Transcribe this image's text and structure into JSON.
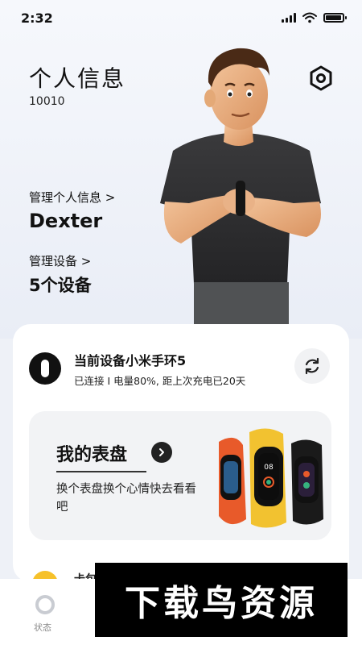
{
  "status_bar": {
    "time": "2:32",
    "battery_level": 0.95
  },
  "header": {
    "title": "个人信息",
    "user_id": "10010"
  },
  "profile": {
    "manage_profile_label": "管理个人信息 >",
    "name": "Dexter",
    "manage_devices_label": "管理设备 >",
    "device_count": "5个设备"
  },
  "device_card": {
    "title": "当前设备小米手环5",
    "status": "已连接 I 电量80%, 距上次充电已20天"
  },
  "watchface_card": {
    "title": "我的表盘",
    "description": "换个表盘换个心情快去看看吧",
    "band_face_text": "08"
  },
  "next_row": {
    "label": "卡包"
  },
  "tabbar": {
    "tabs": [
      {
        "label": "状态"
      }
    ]
  },
  "watermark": {
    "text": "下载鸟资源"
  },
  "colors": {
    "background": "#eef1f7",
    "card": "#ffffff",
    "watchface_bg": "#f2f3f5",
    "band_orange": "#e85a2a",
    "band_yellow": "#f2c230",
    "band_black": "#1a1a1a"
  }
}
